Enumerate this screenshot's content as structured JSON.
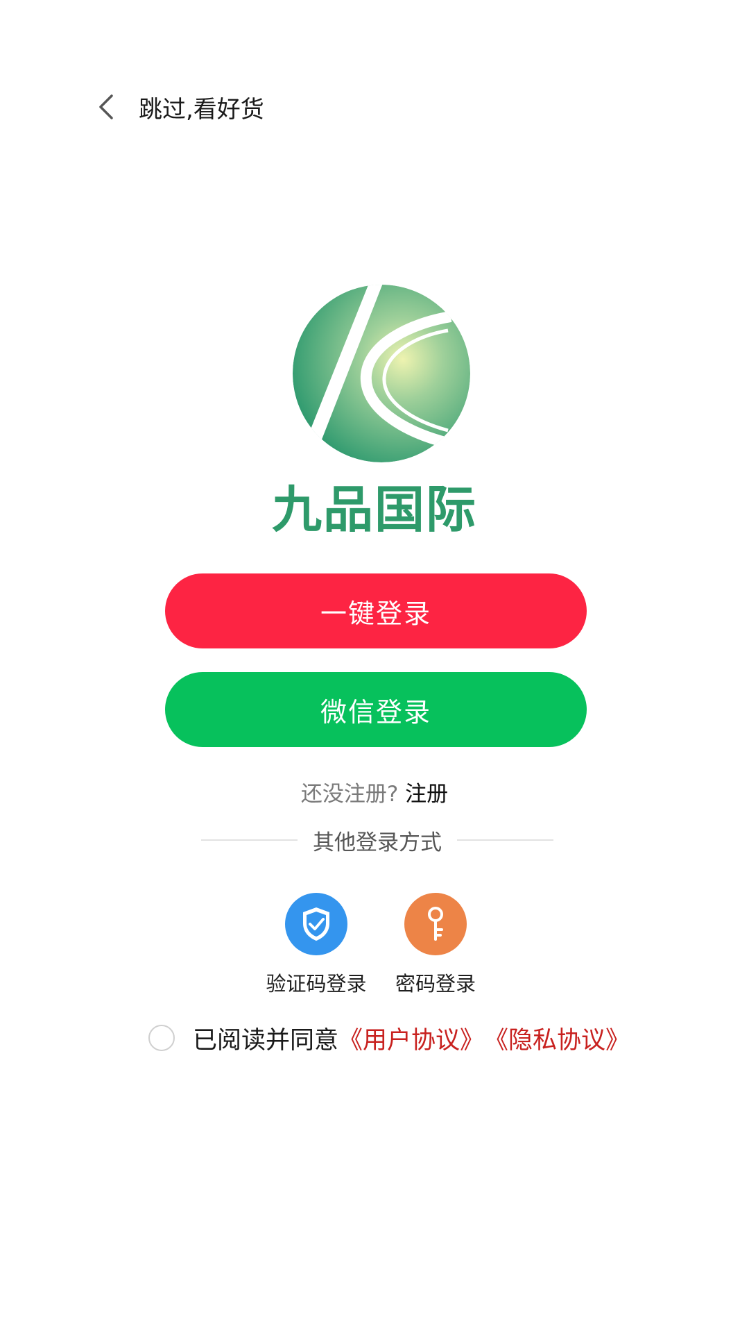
{
  "topbar": {
    "back_icon": "chevron-left-icon",
    "skip_label": "跳过,看好货"
  },
  "brand": {
    "logo_icon": "brand-logo-icon",
    "name": "九品国际",
    "color": "#2e9a6a"
  },
  "buttons": {
    "one_key_login": {
      "label": "一键登录",
      "color": "#fd2443"
    },
    "wechat_login": {
      "label": "微信登录",
      "color": "#07c15c"
    }
  },
  "register": {
    "question": "还没注册?",
    "link": "注册"
  },
  "other_login": {
    "title": "其他登录方式",
    "options": [
      {
        "label": "验证码登录",
        "icon": "shield-check-icon",
        "color": "#3495ee"
      },
      {
        "label": "密码登录",
        "icon": "key-icon",
        "color": "#ed8447"
      }
    ]
  },
  "agreement": {
    "prefix": "已阅读并同意",
    "user_agreement": "《用户协议》",
    "privacy_agreement": "《隐私协议》",
    "link_color": "#c8211f"
  }
}
